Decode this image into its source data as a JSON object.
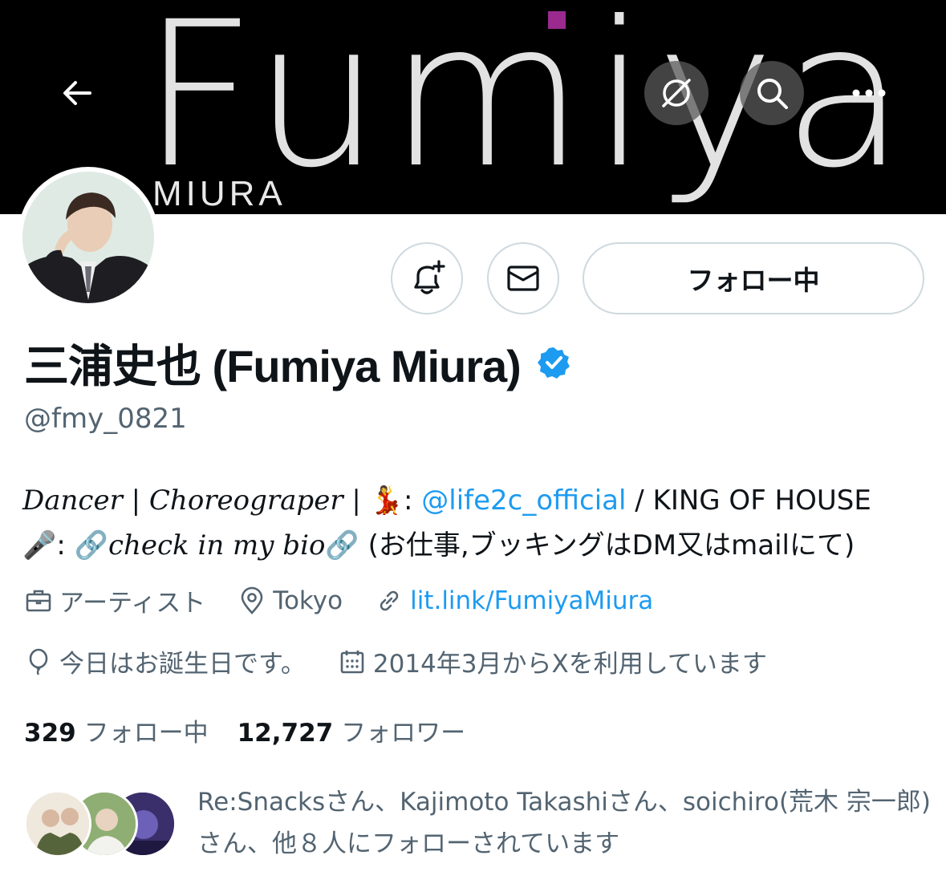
{
  "banner": {
    "wordmark": "Fumiya",
    "sub": "MIURA",
    "dot_color": "#9b2a8f"
  },
  "nav": {
    "back_icon": "arrow-left-icon",
    "grok_icon": "grok-icon",
    "search_icon": "search-icon",
    "more_icon": "more-icon"
  },
  "actions": {
    "notify_icon": "bell-plus-icon",
    "message_icon": "mail-icon",
    "follow_label": "フォロー中"
  },
  "profile": {
    "name": "三浦史也 (Fumiya Miura)",
    "handle": "@fmy_0821",
    "verified_color": "#1d9bf0",
    "bio": {
      "part1": "Dancer | Choreograper | ",
      "emoji_dancer": "💃",
      "sep1": ": ",
      "mention": "@life2c_official",
      "part2": " / KING OF HOUSE",
      "emoji_mic": "🎤",
      "sep2": ": ",
      "emoji_link1": "🔗",
      "check": "check in my bio",
      "emoji_link2": "🔗",
      "part3": "  (お仕事,ブッキングはDM又はmailにて)"
    },
    "category": "アーティスト",
    "location": "Tokyo",
    "website": "lit.link/FumiyaMiura",
    "birthday": "今日はお誕生日です。",
    "joined": "2014年3月からXを利用しています"
  },
  "stats": {
    "following_count": "329",
    "following_label": "フォロー中",
    "followers_count": "12,727",
    "followers_label": "フォロワー"
  },
  "followed_by": {
    "text": "Re:Snacksさん、Kajimoto Takashiさん、soichiro(荒木 宗一郎)さん、他８人にフォローされています"
  },
  "colors": {
    "accent": "#1d9bf0",
    "secondary_text": "#536471",
    "border": "#cfd9de"
  }
}
